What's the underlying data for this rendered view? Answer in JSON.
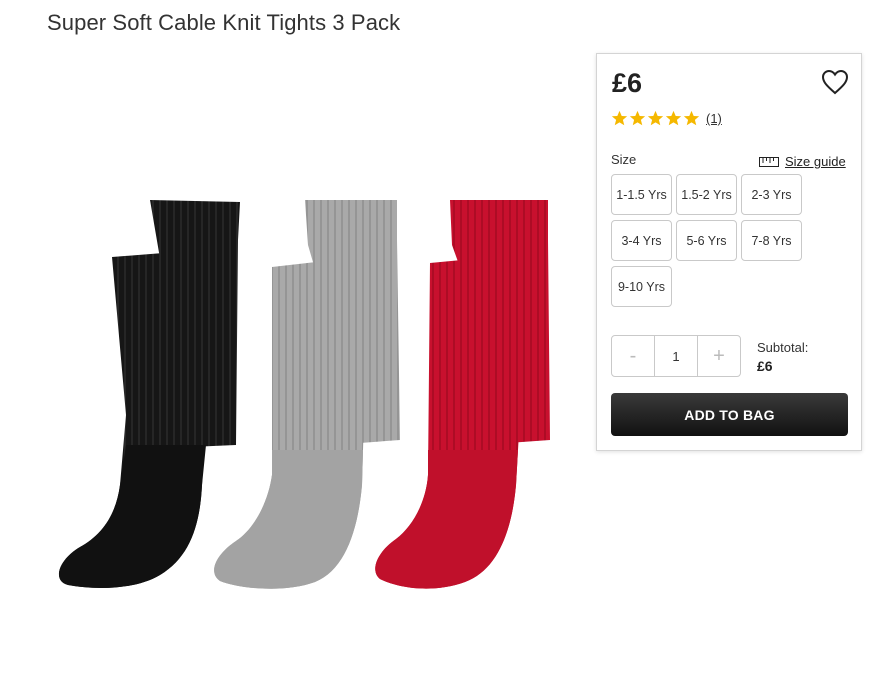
{
  "product": {
    "title": "Super Soft Cable Knit Tights 3 Pack",
    "price": "£6",
    "rating": {
      "stars": 5,
      "max_stars": 5,
      "review_count": "(1)"
    }
  },
  "sizes": {
    "label": "Size",
    "guide_label": "Size guide",
    "options": [
      "1-1.5 Yrs",
      "1.5-2 Yrs",
      "2-3 Yrs",
      "3-4 Yrs",
      "5-6 Yrs",
      "7-8 Yrs",
      "9-10 Yrs"
    ]
  },
  "quantity": {
    "decrement": "-",
    "value": "1",
    "increment": "+"
  },
  "subtotal": {
    "label": "Subtotal:",
    "value": "£6"
  },
  "actions": {
    "add_to_bag": "ADD TO BAG"
  },
  "icons": {
    "wishlist": "heart-icon",
    "rating": "star-icon",
    "size_guide": "ruler-icon"
  },
  "colors": {
    "star": "#f5b800",
    "button_dark": "#1a1a1a",
    "tights": [
      "#151515",
      "#a8a8a8",
      "#c8102e"
    ]
  }
}
